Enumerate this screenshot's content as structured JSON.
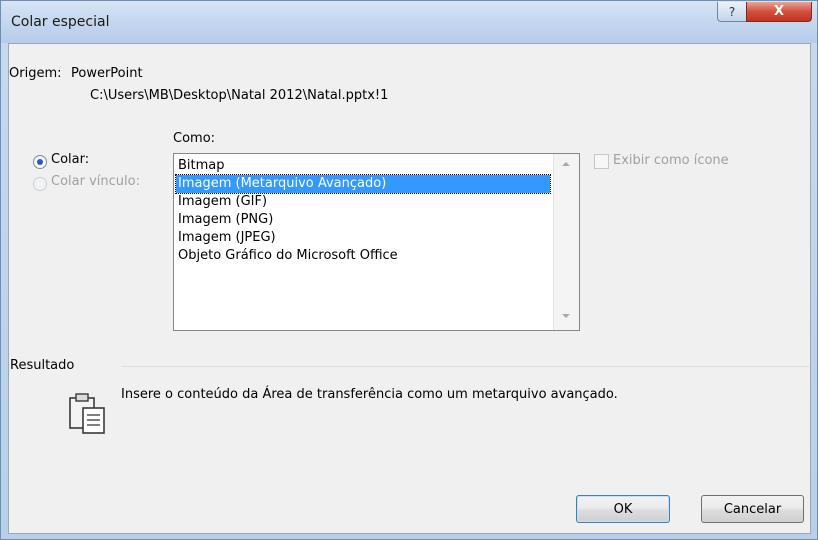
{
  "window": {
    "title": "Colar especial",
    "help_glyph": "?",
    "close_glyph": "X"
  },
  "source": {
    "label": "Origem:",
    "app": "PowerPoint",
    "path": "C:\\Users\\MB\\Desktop\\Natal 2012\\Natal.pptx!1"
  },
  "as_label": "Como:",
  "options": {
    "paste": "Colar:",
    "paste_link": "Colar vínculo:",
    "selected": "paste"
  },
  "formats": {
    "items": [
      "Bitmap",
      "Imagem (Metarquivo Avançado)",
      "Imagem (GIF)",
      "Imagem (PNG)",
      "Imagem (JPEG)",
      "Objeto Gráfico do Microsoft Office"
    ],
    "selected_index": 1
  },
  "display_as_icon": {
    "label": "Exibir como ícone",
    "checked": false
  },
  "result": {
    "label": "Resultado",
    "text": "Insere o conteúdo da Área de transferência como um metarquivo avançado.",
    "icon": "clipboard-paste-icon"
  },
  "buttons": {
    "ok": "OK",
    "cancel": "Cancelar"
  },
  "colors": {
    "selection": "#3399ff",
    "close_button": "#c9402c",
    "accent_radio": "#2b58c6"
  }
}
